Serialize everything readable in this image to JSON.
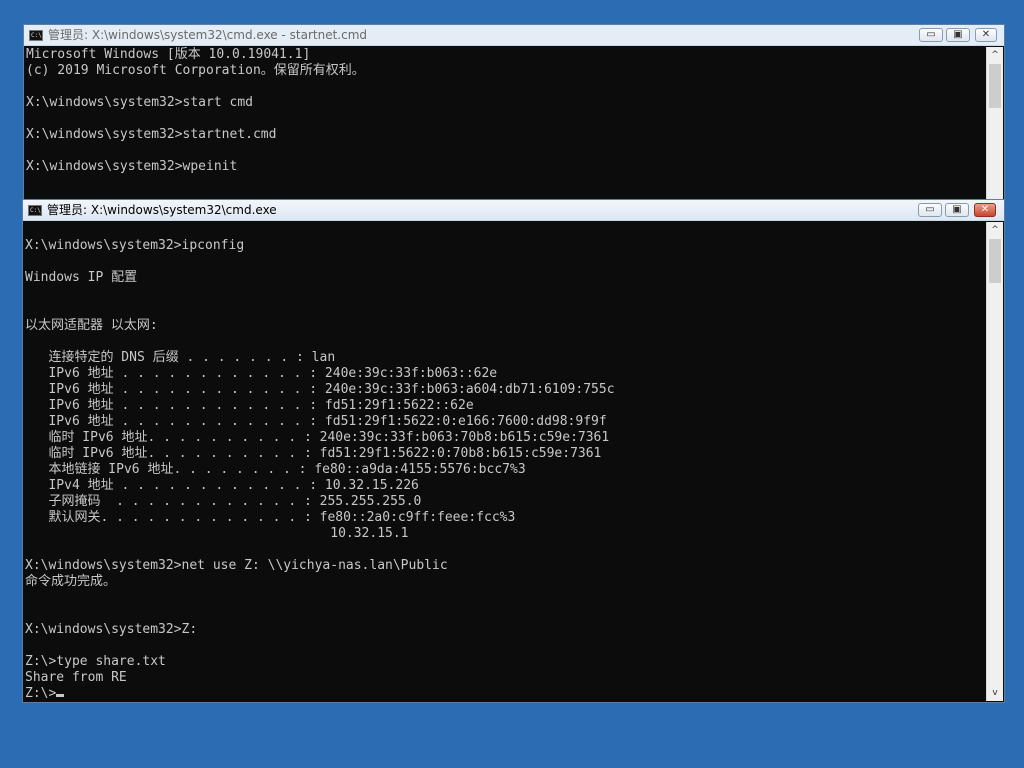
{
  "desktop": {
    "background": "#2b6cb3"
  },
  "window_back": {
    "title": "管理员: X:\\windows\\system32\\cmd.exe - startnet.cmd",
    "icon_text": "C:\\",
    "buttons": {
      "minimize": "▭",
      "maximize": "▣",
      "close": "✕"
    },
    "lines": [
      "Microsoft Windows [版本 10.0.19041.1]",
      "(c) 2019 Microsoft Corporation。保留所有权利。",
      "",
      "X:\\windows\\system32>start cmd",
      "",
      "X:\\windows\\system32>startnet.cmd",
      "",
      "X:\\windows\\system32>wpeinit",
      ""
    ],
    "scroll": {
      "up": "^",
      "down": "v"
    }
  },
  "window_front": {
    "title": "管理员: X:\\windows\\system32\\cmd.exe",
    "icon_text": "C:\\",
    "buttons": {
      "minimize": "▭",
      "maximize": "▣",
      "close": "✕"
    },
    "lines": [
      "",
      "X:\\windows\\system32>ipconfig",
      "",
      "Windows IP 配置",
      "",
      "",
      "以太网适配器 以太网:",
      "",
      "   连接特定的 DNS 后缀 . . . . . . . : lan",
      "   IPv6 地址 . . . . . . . . . . . . : 240e:39c:33f:b063::62e",
      "   IPv6 地址 . . . . . . . . . . . . : 240e:39c:33f:b063:a604:db71:6109:755c",
      "   IPv6 地址 . . . . . . . . . . . . : fd51:29f1:5622::62e",
      "   IPv6 地址 . . . . . . . . . . . . : fd51:29f1:5622:0:e166:7600:dd98:9f9f",
      "   临时 IPv6 地址. . . . . . . . . . : 240e:39c:33f:b063:70b8:b615:c59e:7361",
      "   临时 IPv6 地址. . . . . . . . . . : fd51:29f1:5622:0:70b8:b615:c59e:7361",
      "   本地链接 IPv6 地址. . . . . . . . : fe80::a9da:4155:5576:bcc7%3",
      "   IPv4 地址 . . . . . . . . . . . . : 10.32.15.226",
      "   子网掩码  . . . . . . . . . . . . : 255.255.255.0",
      "   默认网关. . . . . . . . . . . . . : fe80::2a0:c9ff:feee:fcc%3",
      "                                       10.32.15.1",
      "",
      "X:\\windows\\system32>net use Z: \\\\yichya-nas.lan\\Public",
      "命令成功完成。",
      "",
      "",
      "X:\\windows\\system32>Z:",
      "",
      "Z:\\>type share.txt",
      "Share from RE",
      "Z:\\>"
    ],
    "scroll": {
      "up": "^",
      "down": "v"
    }
  }
}
